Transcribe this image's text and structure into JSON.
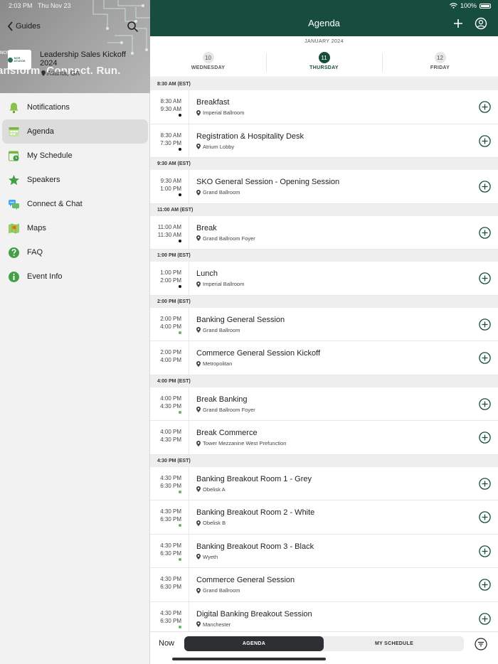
{
  "status_bar": {
    "time": "2:03 PM",
    "date": "Thu Nov 23",
    "battery": "100%"
  },
  "sidebar": {
    "back_label": "Guides",
    "event": {
      "title": "Leadership Sales Kickoff 2024",
      "location": "Atlanta, GA",
      "tagline": "ansform. Connect. Run.",
      "logo_text": "NCR ATLEOS",
      "brand_text": "NCR"
    },
    "items": [
      {
        "label": "Notifications",
        "icon": "bell-icon"
      },
      {
        "label": "Agenda",
        "icon": "agenda-icon"
      },
      {
        "label": "My Schedule",
        "icon": "calendar-icon"
      },
      {
        "label": "Speakers",
        "icon": "star-icon"
      },
      {
        "label": "Connect & Chat",
        "icon": "chat-icon"
      },
      {
        "label": "Maps",
        "icon": "map-icon"
      },
      {
        "label": "FAQ",
        "icon": "help-icon"
      },
      {
        "label": "Event Info",
        "icon": "info-icon"
      }
    ],
    "active_index": 1
  },
  "header": {
    "title": "Agenda"
  },
  "dates": {
    "month": "JANUARY 2024",
    "days": [
      {
        "num": "10",
        "name": "WEDNESDAY"
      },
      {
        "num": "11",
        "name": "THURSDAY"
      },
      {
        "num": "12",
        "name": "FRIDAY"
      }
    ],
    "active_index": 1
  },
  "slots": [
    {
      "header": "8:30 AM (EST)",
      "sessions": [
        {
          "start": "8:30 AM",
          "end": "9:30 AM",
          "name": "Breakfast",
          "location": "Imperial Ballroom",
          "dot": "black"
        },
        {
          "start": "8:30 AM",
          "end": "7:30 PM",
          "name": "Registration & Hospitality Desk",
          "location": "Atrium Lobby",
          "dot": "black"
        }
      ]
    },
    {
      "header": "9:30 AM (EST)",
      "sessions": [
        {
          "start": "9:30 AM",
          "end": "1:00 PM",
          "name": "SKO General Session - Opening Session",
          "location": "Grand Ballroom",
          "dot": "black"
        }
      ]
    },
    {
      "header": "11:00 AM (EST)",
      "sessions": [
        {
          "start": "11:00 AM",
          "end": "11:30 AM",
          "name": "Break",
          "location": "Grand Ballroom Foyer",
          "dot": "black"
        }
      ]
    },
    {
      "header": "1:00 PM (EST)",
      "sessions": [
        {
          "start": "1:00 PM",
          "end": "2:00 PM",
          "name": "Lunch",
          "location": "Imperial Ballroom",
          "dot": "black"
        }
      ]
    },
    {
      "header": "2:00 PM (EST)",
      "sessions": [
        {
          "start": "2:00 PM",
          "end": "4:00 PM",
          "name": "Banking General Session",
          "location": "Grand Ballroom",
          "dot": "green"
        },
        {
          "start": "2:00 PM",
          "end": "4:00 PM",
          "name": "Commerce General Session Kickoff",
          "location": "Metropolitan",
          "dot": "none"
        }
      ]
    },
    {
      "header": "4:00 PM (EST)",
      "sessions": [
        {
          "start": "4:00 PM",
          "end": "4:30 PM",
          "name": "Break Banking",
          "location": "Grand Ballroom Foyer",
          "dot": "green"
        },
        {
          "start": "4:00 PM",
          "end": "4:30 PM",
          "name": "Break Commerce",
          "location": "Tower Mezzanine West Prefunction",
          "dot": "none"
        }
      ]
    },
    {
      "header": "4:30 PM (EST)",
      "sessions": [
        {
          "start": "4:30 PM",
          "end": "6:30 PM",
          "name": "Banking Breakout Room 1 - Grey",
          "location": "Obelisk A",
          "dot": "green"
        },
        {
          "start": "4:30 PM",
          "end": "6:30 PM",
          "name": "Banking Breakout Room 2 - White",
          "location": "Obelisk B",
          "dot": "green"
        },
        {
          "start": "4:30 PM",
          "end": "6:30 PM",
          "name": "Banking Breakout Room 3 - Black",
          "location": "Wyeth",
          "dot": "green"
        },
        {
          "start": "4:30 PM",
          "end": "6:30 PM",
          "name": "Commerce General Session",
          "location": "Grand Ballroom",
          "dot": "none"
        },
        {
          "start": "4:30 PM",
          "end": "6:30 PM",
          "name": "Digital Banking Breakout Session",
          "location": "Manchester",
          "dot": "green"
        }
      ]
    }
  ],
  "bottom": {
    "now_label": "Now",
    "tabs": [
      "AGENDA",
      "MY SCHEDULE"
    ],
    "active_tab": 0
  },
  "colors": {
    "primary": "#174d3c",
    "green_dot": "#5cb85c",
    "segment_active": "#2d2f33"
  }
}
